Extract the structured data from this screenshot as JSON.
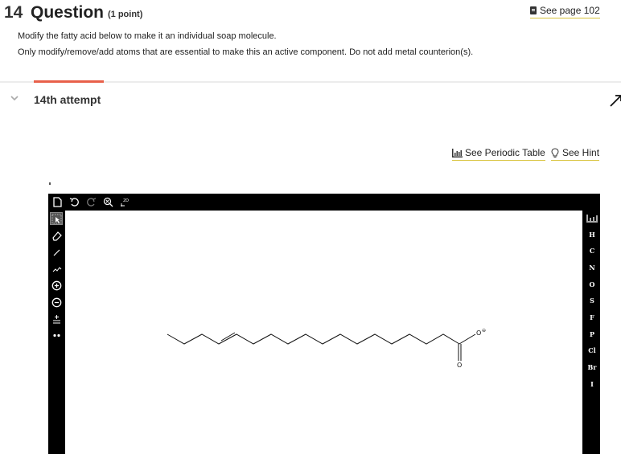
{
  "question": {
    "number": "14",
    "title": "Question",
    "points": "(1 point)",
    "see_page": "See page 102",
    "instruction_1": "Modify the fatty acid below to make it an individual soap molecule.",
    "instruction_2": "Only modify/remove/add atoms that are essential to make this an active component. Do not add metal counterion(s)."
  },
  "attempt": {
    "label": "14th attempt"
  },
  "tools": {
    "periodic_table": "See Periodic Table",
    "hint": "See Hint"
  },
  "editor": {
    "top_toolbar": [
      "new-document",
      "undo",
      "redo",
      "zoom",
      "2d-clean"
    ],
    "left_toolbar": [
      "select",
      "eraser",
      "single-bond",
      "chain",
      "positive-charge",
      "negative-charge",
      "lone-pair-add",
      "radical"
    ],
    "elements": [
      "H",
      "C",
      "N",
      "O",
      "S",
      "F",
      "P",
      "Cl",
      "Br",
      "I"
    ],
    "clean_label": "2D",
    "molecule": {
      "atom_labels": [
        "O",
        "O",
        "⊖"
      ]
    }
  },
  "colors": {
    "accent": "#e8604a",
    "link_underline": "#d8c23a",
    "editor_frame": "#000000"
  }
}
